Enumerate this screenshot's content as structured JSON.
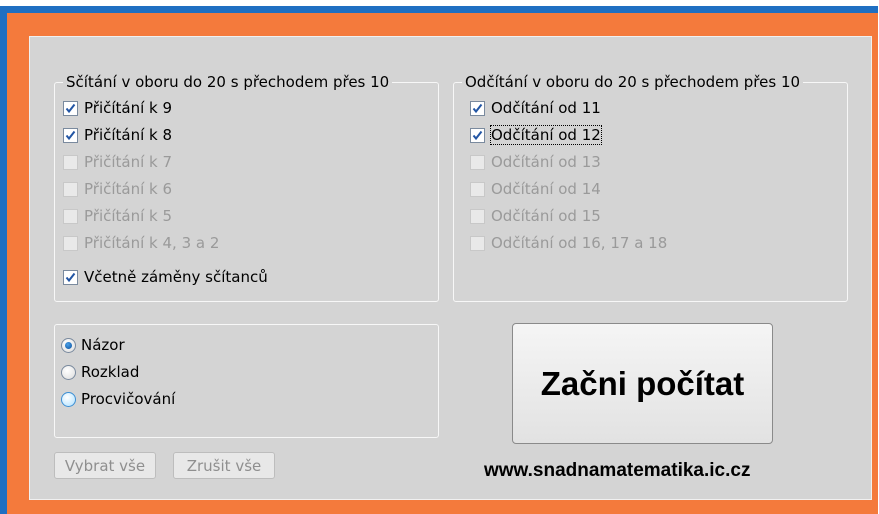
{
  "addition_group": {
    "title": "Sčítání v oboru do 20 s přechodem přes 10",
    "items": [
      {
        "label": "Přičítání k 9",
        "checked": true,
        "enabled": true
      },
      {
        "label": "Přičítání k 8",
        "checked": true,
        "enabled": true
      },
      {
        "label": "Přičítání k 7",
        "checked": false,
        "enabled": false
      },
      {
        "label": "Přičítání k 6",
        "checked": false,
        "enabled": false
      },
      {
        "label": "Přičítání k 5",
        "checked": false,
        "enabled": false
      },
      {
        "label": "Přičítání k 4, 3 a 2",
        "checked": false,
        "enabled": false
      }
    ],
    "swap_option": {
      "label": "Včetně záměny sčítanců",
      "checked": true
    }
  },
  "subtraction_group": {
    "title": "Odčítání v oboru do 20 s přechodem přes 10",
    "items": [
      {
        "label": "Odčítání od 11",
        "checked": true,
        "enabled": true
      },
      {
        "label": "Odčítání od 12",
        "checked": true,
        "enabled": true
      },
      {
        "label": "Odčítání od 13",
        "checked": false,
        "enabled": false
      },
      {
        "label": "Odčítání od 14",
        "checked": false,
        "enabled": false
      },
      {
        "label": "Odčítání od 15",
        "checked": false,
        "enabled": false
      },
      {
        "label": "Odčítání od  16, 17 a 18",
        "checked": false,
        "enabled": false
      }
    ]
  },
  "mode_group": {
    "options": [
      {
        "label": "Názor",
        "selected": true
      },
      {
        "label": "Rozklad",
        "selected": false
      },
      {
        "label": "Procvičování",
        "selected": false
      }
    ]
  },
  "buttons": {
    "select_all": "Vybrat vše",
    "clear_all": "Zrušit vše",
    "start": "Začni počítat"
  },
  "website": "www.snadnamatematika.ic.cz",
  "colors": {
    "outer_border": "#1f6fc2",
    "inner_border": "#f47a3c",
    "panel": "#d4d4d4",
    "check": "#2255a4"
  }
}
